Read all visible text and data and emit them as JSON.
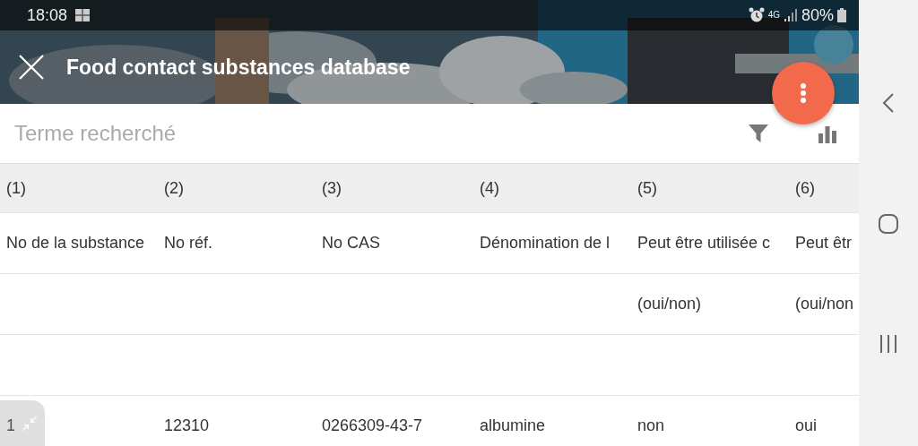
{
  "status_bar": {
    "time": "18:08",
    "network": "4G",
    "battery": "80%"
  },
  "app_bar": {
    "title": "Food contact substances database"
  },
  "search": {
    "placeholder": "Terme recherché"
  },
  "table": {
    "rows": [
      {
        "kind": "index",
        "cells": [
          "(1)",
          "(2)",
          "(3)",
          "(4)",
          "(5)",
          "(6)"
        ]
      },
      {
        "kind": "heading",
        "cells": [
          "No de la substance",
          "No réf.",
          "No CAS",
          "Dénomination de l",
          "Peut être utilisée c",
          "Peut êtr"
        ]
      },
      {
        "kind": "plain",
        "cells": [
          null,
          null,
          null,
          null,
          "(oui/non)",
          "(oui/non"
        ]
      },
      {
        "kind": "plain",
        "cells": [
          null,
          null,
          null,
          null,
          null,
          null
        ]
      },
      {
        "kind": "plain",
        "cells": [
          "1",
          "12310",
          "0266309-43-7",
          "albumine",
          "non",
          "oui"
        ]
      }
    ]
  }
}
